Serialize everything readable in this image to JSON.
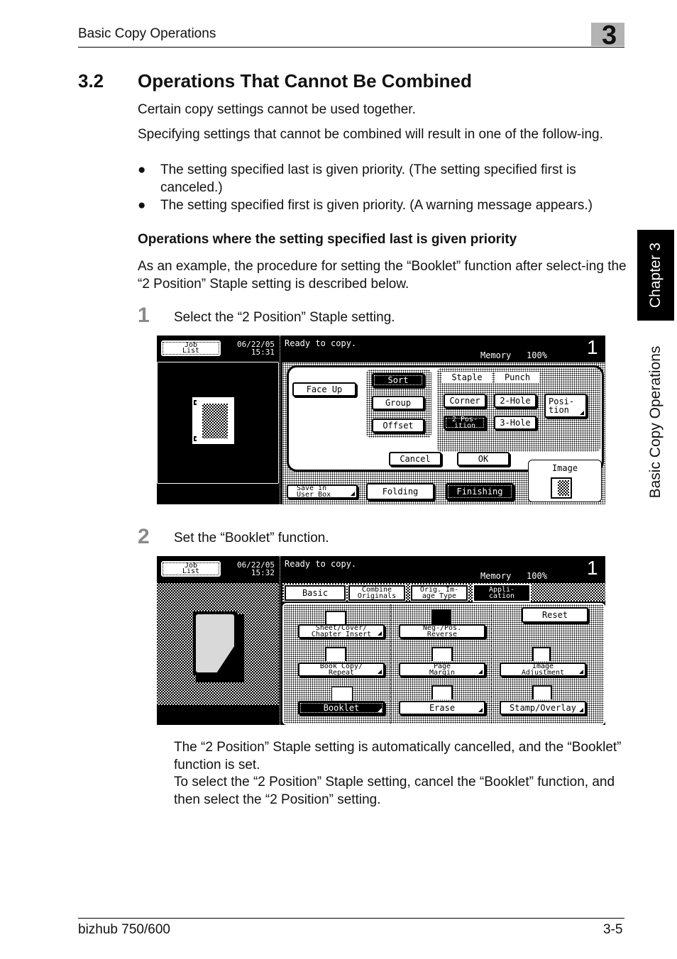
{
  "header": {
    "title": "Basic Copy Operations",
    "chapter_number": "3"
  },
  "section": {
    "number": "3.2",
    "title": "Operations That Cannot Be Combined",
    "intro1": "Certain copy settings cannot be used together.",
    "intro2": "Specifying settings that cannot be combined will result in one of the follow-ing.",
    "bullets": [
      "The setting specified last is given priority. (The setting specified first is canceled.)",
      "The setting specified first is given priority. (A warning message appears.)"
    ],
    "bullet_glyph": "●",
    "subheading": "Operations where the setting specified last is given priority",
    "example": "As an example, the procedure for setting the “Booklet” function after select-ing the “2 Position” Staple setting is described below."
  },
  "steps": [
    {
      "number": "1",
      "text": "Select the “2 Position” Staple setting."
    },
    {
      "number": "2",
      "text": "Set the “Booklet” function."
    }
  ],
  "screen1": {
    "job_list": [
      "Job",
      "List"
    ],
    "date": "06/22/05",
    "time": "15:31",
    "status": "Ready to copy.",
    "memory_label": "Memory",
    "memory_value": "100%",
    "copy_count": "1",
    "face_up": "Face Up",
    "sort": "Sort",
    "group": "Group",
    "offset": "Offset",
    "staple_label": "Staple",
    "punch_label": "Punch",
    "corner": "Corner",
    "two_position": [
      "2 Pos-",
      "ition"
    ],
    "two_hole": "2-Hole",
    "three_hole": "3-Hole",
    "position": [
      "Posi-",
      "tion"
    ],
    "cancel": "Cancel",
    "ok": "OK",
    "image_label": "Image",
    "save_user_box": [
      "Save in",
      "User Box"
    ],
    "folding": "Folding",
    "finishing": "Finishing"
  },
  "screen2": {
    "job_list": [
      "Job",
      "List"
    ],
    "date": "06/22/05",
    "time": "15:32",
    "status": "Ready to copy.",
    "memory_label": "Memory",
    "memory_value": "100%",
    "copy_count": "1",
    "tabs": [
      {
        "label": [
          "Basic"
        ]
      },
      {
        "label": [
          "Combine",
          "Originals"
        ]
      },
      {
        "label": [
          "Orig. Im-",
          "age Type"
        ]
      },
      {
        "label": [
          "Appli-",
          "cation"
        ]
      }
    ],
    "reset": "Reset",
    "functions": [
      {
        "label": [
          "Sheet/Cover/",
          "Chapter Insert"
        ],
        "icon": "sheet-insert-icon"
      },
      {
        "label": [
          "Neg-/Pos.",
          "Reverse"
        ],
        "icon": "neg-pos-icon"
      },
      {
        "label": [
          "Book Copy/",
          "Repeat"
        ],
        "icon": "book-copy-icon"
      },
      {
        "label": [
          "Page",
          "Margin"
        ],
        "icon": "page-margin-icon"
      },
      {
        "label": [
          "Image",
          "Adjustment"
        ],
        "icon": "image-adjust-icon"
      },
      {
        "label": [
          "Booklet"
        ],
        "icon": "booklet-icon"
      },
      {
        "label": [
          "Erase"
        ],
        "icon": "erase-icon"
      },
      {
        "label": [
          "Stamp/Overlay"
        ],
        "icon": "stamp-icon"
      }
    ]
  },
  "result": {
    "line1": "The “2 Position” Staple setting is automatically cancelled, and the “Booklet” function is set.",
    "line2": "To select the “2 Position” Staple setting, cancel the “Booklet” function, and then select the “2 Position” setting."
  },
  "side": {
    "chapter_tab": "Chapter 3",
    "section_label": "Basic Copy Operations"
  },
  "footer": {
    "model": "bizhub 750/600",
    "page": "3-5"
  }
}
